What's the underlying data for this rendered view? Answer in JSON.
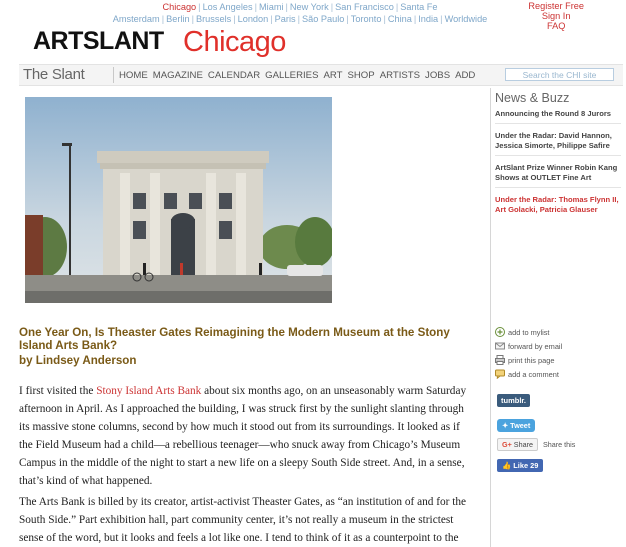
{
  "cities": {
    "row1": [
      "Chicago",
      "Los Angeles",
      "Miami",
      "New York",
      "San Francisco",
      "Santa Fe"
    ],
    "row2": [
      "Amsterdam",
      "Berlin",
      "Brussels",
      "London",
      "Paris",
      "São Paulo",
      "Toronto",
      "China",
      "India",
      "Worldwide"
    ],
    "active": "Chicago"
  },
  "account": {
    "register": "Register Free",
    "signin": "Sign In",
    "faq": "FAQ"
  },
  "logo": {
    "brand": "ARTSLANT",
    "city": "Chicago"
  },
  "nav": {
    "slant": "The Slant",
    "items": [
      "HOME",
      "MAGAZINE",
      "CALENDAR",
      "GALLERIES",
      "ART",
      "SHOP",
      "ARTISTS",
      "JOBS",
      "ADD"
    ],
    "search_placeholder": "Search the CHI site"
  },
  "article": {
    "title": "One Year On, Is Theaster Gates Reimagining the Modern Museum at the Stony Island Arts Bank?",
    "byline": "by Lindsey Anderson",
    "p1_before": "I first visited the ",
    "p1_link": "Stony Island Arts Bank",
    "p1_after": " about six months ago, on an unseasonably warm Saturday afternoon in April. As I approached the building, I was struck first by the sunlight slanting through its massive stone columns, second by how much it stood out from its surroundings. It looked as if the Field Museum had a child—a rebellious teenager—who snuck away from Chicago’s Museum Campus in the middle of the night to start a new life on a sleepy South Side street. And, in a sense, that’s kind of what happened.",
    "p2": "The Arts Bank is billed by its creator, artist-activist Theaster Gates, as “an institution of and for the South Side.” Part exhibition hall, part community center, it’s not really a museum in the strictest sense of the word, but it looks and feels a lot like one. I tend to think of it as a counterpoint to the more centrally"
  },
  "sidebar": {
    "title": "News & Buzz",
    "items": [
      {
        "text": "Announcing the Round 8 Jurors",
        "red": false
      },
      {
        "text": "Under the Radar: David Hannon, Jessica Simorte, Philippe Safire",
        "red": false
      },
      {
        "text": "ArtSlant Prize Winner Robin Kang Shows at OUTLET Fine Art",
        "red": false
      },
      {
        "text": "Under the Radar: Thomas Flynn II, Art Golacki, Patricia Glauser",
        "red": true
      }
    ],
    "actions": [
      {
        "label": "add to mylist",
        "icon": "plus-icon"
      },
      {
        "label": "forward by email",
        "icon": "email-icon"
      },
      {
        "label": "print this page",
        "icon": "print-icon"
      },
      {
        "label": "add a comment",
        "icon": "comment-icon"
      }
    ],
    "tumblr": "tumblr.",
    "tweet": "Tweet",
    "gshare": "Share",
    "gshare_text": "Share this",
    "fblike": "Like 29"
  },
  "colors": {
    "accent_red": "#e0302a",
    "title_brown": "#7a5a17",
    "link_blue": "#7fa7c9"
  }
}
